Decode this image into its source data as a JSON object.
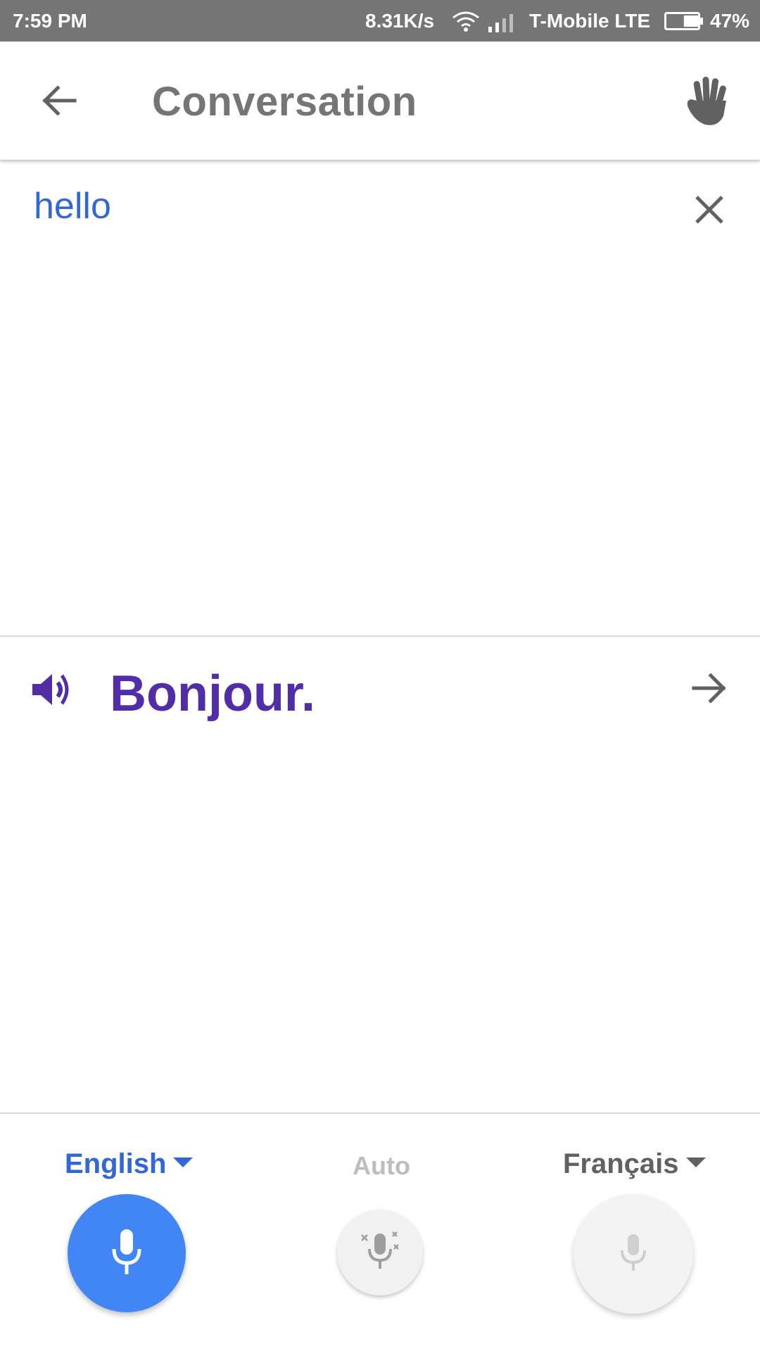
{
  "status_bar": {
    "time": "7:59 PM",
    "speed": "8.31K/s",
    "carrier": "T-Mobile LTE",
    "battery_percent": "47%",
    "battery_level": 0.47,
    "icons": [
      "wifi-icon",
      "signal-icon",
      "battery-icon"
    ]
  },
  "app_bar": {
    "title": "Conversation",
    "icons": [
      "back-arrow-icon",
      "hand-wave-icon"
    ]
  },
  "source": {
    "text": "hello",
    "icons": [
      "close-icon"
    ]
  },
  "target": {
    "text": "Bonjour.",
    "icons": [
      "speaker-icon",
      "forward-arrow-icon"
    ]
  },
  "bottom": {
    "left_language": "English",
    "auto_label": "Auto",
    "right_language": "Français",
    "icons": [
      "microphone-icon",
      "auto-microphone-icon",
      "caret-down-icon"
    ]
  },
  "colors": {
    "status_bar": "#757575",
    "source_text": "#3367d6",
    "target_text": "#512da8",
    "mic_active": "#4285f4",
    "mic_inactive": "#f3f3f3"
  }
}
